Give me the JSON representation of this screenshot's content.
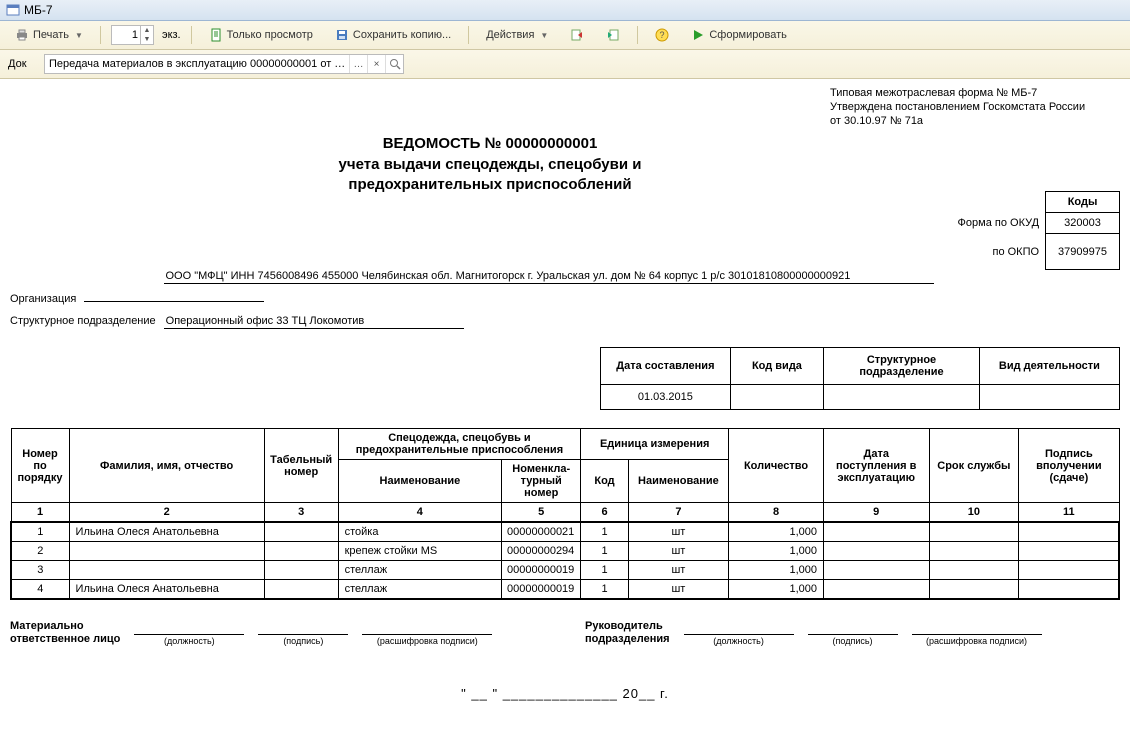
{
  "window": {
    "title": "МБ-7"
  },
  "toolbar": {
    "print": "Печать",
    "copies_value": "1",
    "copies_label": "экз.",
    "view_only": "Только просмотр",
    "save_copy": "Сохранить копию...",
    "actions": "Действия",
    "generate": "Сформировать"
  },
  "doc_ref": {
    "label": "Док",
    "value": "Передача материалов в эксплуатацию 00000000001 от …"
  },
  "form_note": {
    "line1": "Типовая межотраслевая форма № МБ-7",
    "line2": "Утверждена постановлением Госкомстата России",
    "line3": "от 30.10.97 № 71а"
  },
  "title": {
    "line1": "ВЕДОМОСТЬ № 00000000001",
    "line2": "учета выдачи спецодежды, спецобуви и",
    "line3": "предохранительных приспособлений"
  },
  "codes": {
    "header": "Коды",
    "okud_label": "Форма по ОКУД",
    "okud_value": "320003",
    "okpo_label": "по ОКПО",
    "okpo_value": "37909975"
  },
  "org": {
    "org_label": "Организация",
    "org_value": "ООО \"МФЦ\"  ИНН 7456008496  455000  Челябинская обл. Магнитогорск г. Уральская ул. дом № 64  корпус 1  р/с  30101810800000000921",
    "unit_label": "Структурное подразделение",
    "unit_value": "Операционный офис 33  ТЦ Локомотив"
  },
  "meta": {
    "h_date": "Дата составления",
    "h_kind": "Код вида",
    "h_unit": "Структурное подразделение",
    "h_activity": "Вид деятельности",
    "date": "01.03.2015",
    "kind": "",
    "unit": "",
    "activity": ""
  },
  "columns": {
    "c1": "Номер по порядку",
    "c2": "Фамилия, имя, отчество",
    "c3": "Табельный номер",
    "g45": "Спецодежда, спецобувь и предохранительные приспособления",
    "c4": "Наименование",
    "c5": "Номенкла-турный номер",
    "g67": "Единица измерения",
    "c6": "Код",
    "c7": "Наименование",
    "c8": "Количество",
    "c9": "Дата поступления в эксплуатацию",
    "c10": "Срок службы",
    "c11": "Подпись вполучении (сдаче)",
    "n1": "1",
    "n2": "2",
    "n3": "3",
    "n4": "4",
    "n5": "5",
    "n6": "6",
    "n7": "7",
    "n8": "8",
    "n9": "9",
    "n10": "10",
    "n11": "11"
  },
  "rows": [
    {
      "n": "1",
      "fio": "Ильина Олеся Анатольевна",
      "tab": "",
      "item": "стойка",
      "nom": "00000000021",
      "ucode": "1",
      "uname": "шт",
      "qty": "1,000"
    },
    {
      "n": "2",
      "fio": "",
      "tab": "",
      "item": "крепеж стойки MS",
      "nom": "00000000294",
      "ucode": "1",
      "uname": "шт",
      "qty": "1,000"
    },
    {
      "n": "3",
      "fio": "",
      "tab": "",
      "item": "стеллаж",
      "nom": "00000000019",
      "ucode": "1",
      "uname": "шт",
      "qty": "1,000"
    },
    {
      "n": "4",
      "fio": "Ильина Олеся Анатольевна",
      "tab": "",
      "item": "стеллаж",
      "nom": "00000000019",
      "ucode": "1",
      "uname": "шт",
      "qty": "1,000"
    }
  ],
  "sign": {
    "mol": "Материально\nответственное лицо",
    "head": "Руководитель\nподразделения",
    "position": "(должность)",
    "signature": "(подпись)",
    "decipher": "(расшифровка подписи)"
  },
  "date_fill": "\" __ \"   ______________   20__ г."
}
